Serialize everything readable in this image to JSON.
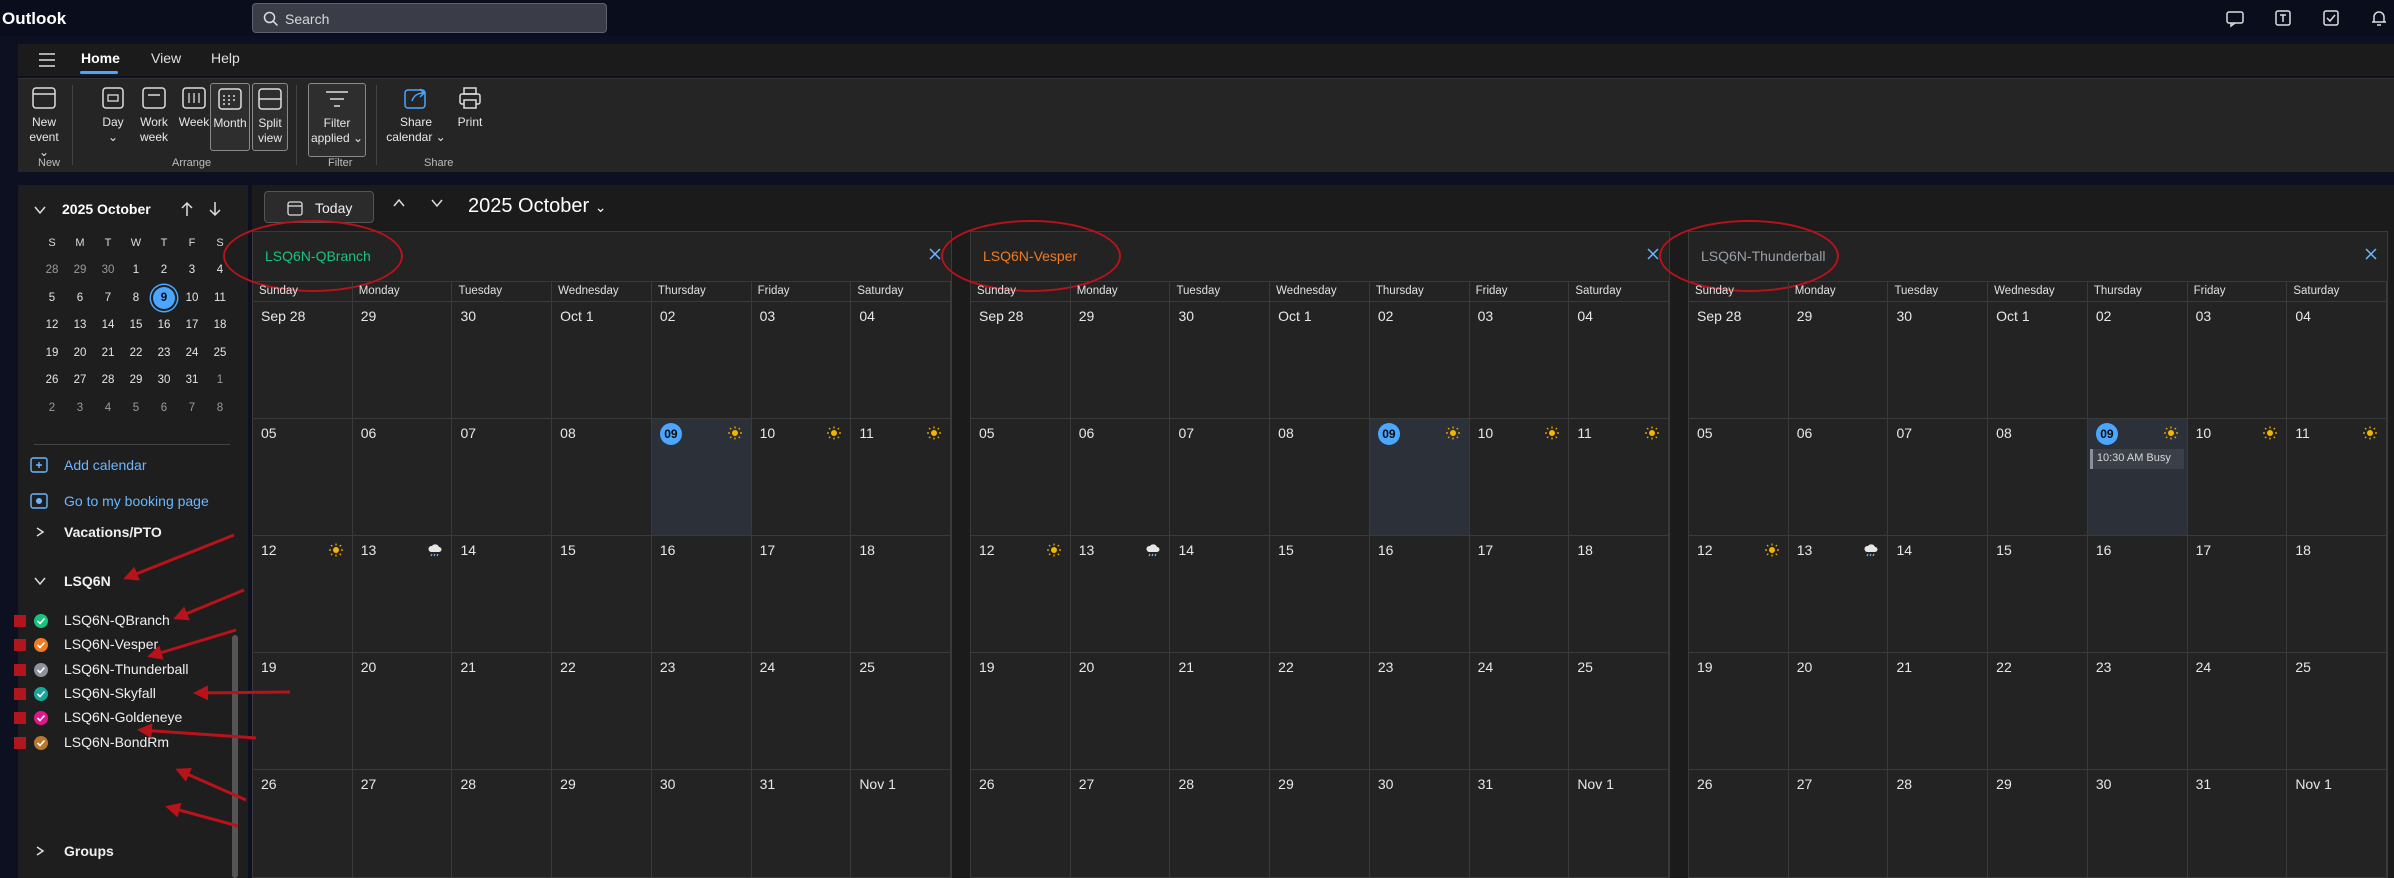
{
  "app": {
    "name": "Outlook"
  },
  "search": {
    "placeholder": "Search"
  },
  "ribbon": {
    "tabs": [
      "Home",
      "View",
      "Help"
    ],
    "buttons": {
      "new_event": [
        "New",
        "event"
      ],
      "day": "Day",
      "work_week": [
        "Work",
        "week"
      ],
      "week": "Week",
      "month": "Month",
      "split_view": [
        "Split",
        "view"
      ],
      "filter": [
        "Filter",
        "applied"
      ],
      "share": [
        "Share",
        "calendar"
      ],
      "print": "Print"
    },
    "groups": [
      "New",
      "Arrange",
      "Filter",
      "Share"
    ]
  },
  "minical": {
    "title": "2025 October",
    "dow": [
      "S",
      "M",
      "T",
      "W",
      "T",
      "F",
      "S"
    ],
    "weeks": [
      [
        "28",
        "29",
        "30",
        "1",
        "2",
        "3",
        "4"
      ],
      [
        "5",
        "6",
        "7",
        "8",
        "9",
        "10",
        "11"
      ],
      [
        "12",
        "13",
        "14",
        "15",
        "16",
        "17",
        "18"
      ],
      [
        "19",
        "20",
        "21",
        "22",
        "23",
        "24",
        "25"
      ],
      [
        "26",
        "27",
        "28",
        "29",
        "30",
        "31",
        "1"
      ],
      [
        "2",
        "3",
        "4",
        "5",
        "6",
        "7",
        "8"
      ]
    ],
    "today": "9"
  },
  "sidebar": {
    "add_calendar": "Add calendar",
    "booking": "Go to my booking page",
    "vacations": "Vacations/PTO",
    "group_name": "LSQ6N",
    "calendars": [
      {
        "name": "LSQ6N-QBranch",
        "color": "#19c37d"
      },
      {
        "name": "LSQ6N-Vesper",
        "color": "#f07b22"
      },
      {
        "name": "LSQ6N-Thunderball",
        "color": "#8d939c"
      },
      {
        "name": "LSQ6N-Skyfall",
        "color": "#1aa59b"
      },
      {
        "name": "LSQ6N-Goldeneye",
        "color": "#e0178a"
      },
      {
        "name": "LSQ6N-BondRm",
        "color": "#b9782d"
      }
    ],
    "groups_label": "Groups"
  },
  "toolbar": {
    "today": "Today",
    "month_title": "2025 October"
  },
  "calendar": {
    "dow": [
      "Sunday",
      "Monday",
      "Tuesday",
      "Wednesday",
      "Thursday",
      "Friday",
      "Saturday"
    ],
    "weeks": [
      [
        "Sep 28",
        "29",
        "30",
        "Oct 1",
        "02",
        "03",
        "04"
      ],
      [
        "05",
        "06",
        "07",
        "08",
        "09",
        "10",
        "11"
      ],
      [
        "12",
        "13",
        "14",
        "15",
        "16",
        "17",
        "18"
      ],
      [
        "19",
        "20",
        "21",
        "22",
        "23",
        "24",
        "25"
      ],
      [
        "26",
        "27",
        "28",
        "29",
        "30",
        "31",
        "Nov 1"
      ]
    ],
    "panels": [
      {
        "name": "LSQ6N-QBranch",
        "color": "#19c37d",
        "event": ""
      },
      {
        "name": "LSQ6N-Vesper",
        "color": "#f07b22",
        "event": ""
      },
      {
        "name": "LSQ6N-Thunderball",
        "color": "#9aa0a8",
        "event": "10:30 AM Busy"
      }
    ]
  },
  "accent": "#4aa6ff",
  "annotation_color": "#b8121a"
}
